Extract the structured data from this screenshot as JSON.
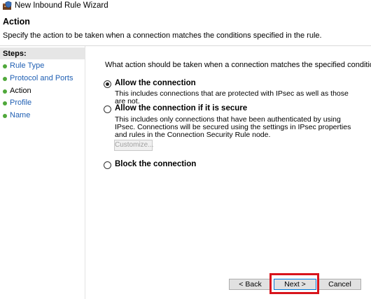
{
  "window": {
    "title": "New Inbound Rule Wizard",
    "icon": "firewall-shield-icon"
  },
  "header": {
    "title": "Action",
    "description": "Specify the action to be taken when a connection matches the conditions specified in the rule."
  },
  "sidebar": {
    "title": "Steps:",
    "items": [
      {
        "label": "Rule Type",
        "current": false
      },
      {
        "label": "Protocol and Ports",
        "current": false
      },
      {
        "label": "Action",
        "current": true
      },
      {
        "label": "Profile",
        "current": false
      },
      {
        "label": "Name",
        "current": false
      }
    ]
  },
  "main": {
    "question": "What action should be taken when a connection matches the specified conditions?",
    "options": [
      {
        "label": "Allow the connection",
        "description": "This includes connections that are protected with IPsec as well as those are not.",
        "selected": true
      },
      {
        "label": "Allow the connection if it is secure",
        "description": "This includes only connections that have been authenticated by using IPsec.  Connections will be secured using the settings in IPsec properties and rules in the Connection Security Rule node.",
        "selected": false,
        "button": "Customize..."
      },
      {
        "label": "Block the connection",
        "selected": false
      }
    ]
  },
  "footer": {
    "back": "< Back",
    "next": "Next >",
    "cancel": "Cancel"
  },
  "colors": {
    "highlight": "#d8141c",
    "step_dot": "#4fa83a",
    "link": "#1f5fb3"
  }
}
